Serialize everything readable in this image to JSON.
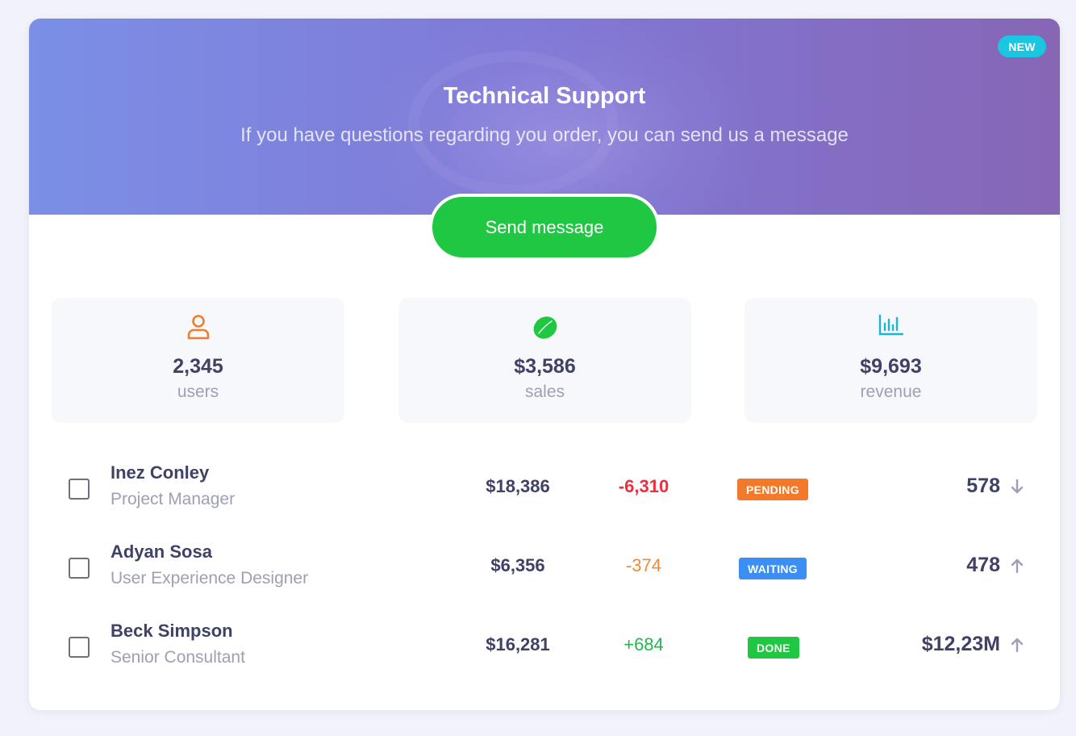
{
  "banner": {
    "badge": "NEW",
    "title": "Technical Support",
    "subtitle": "If you have questions regarding you order, you can send us a message",
    "button": "Send message"
  },
  "stats": [
    {
      "icon": "user-icon",
      "value": "2,345",
      "label": "users",
      "color": "#f07d2f"
    },
    {
      "icon": "lemon-icon",
      "value": "$3,586",
      "label": "sales",
      "color": "#20c743"
    },
    {
      "icon": "bar-chart-icon",
      "value": "$9,693",
      "label": "revenue",
      "color": "#18b6d2"
    }
  ],
  "rows": [
    {
      "name": "Inez Conley",
      "role": "Project Manager",
      "amount": "$18,386",
      "delta": "-6,310",
      "delta_color": "#ee2e3e",
      "status": "PENDING",
      "status_color": "#f47a2b",
      "metric": "578",
      "trend": "down"
    },
    {
      "name": "Adyan Sosa",
      "role": "User Experience Designer",
      "amount": "$6,356",
      "delta": "-374",
      "delta_color": "#f08a3a",
      "status": "WAITING",
      "status_color": "#3b8ef3",
      "metric": "478",
      "trend": "up"
    },
    {
      "name": "Beck Simpson",
      "role": "Senior Consultant",
      "amount": "$16,281",
      "delta": "+684",
      "delta_color": "#20b84a",
      "status": "DONE",
      "status_color": "#20c743",
      "metric": "$12,23M",
      "trend": "up"
    }
  ],
  "colors": {
    "accent_green": "#20c743",
    "text_dark": "#3f4266",
    "text_muted": "#9da0b4"
  }
}
